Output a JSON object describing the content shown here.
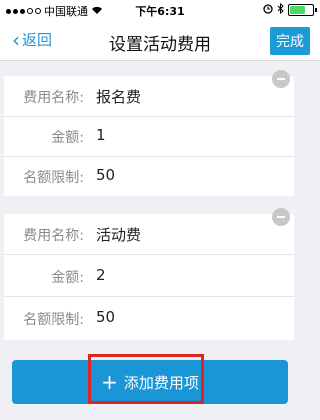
{
  "status": {
    "carrier": "中国联通",
    "time": "下午6:31",
    "battery_level": 0.75
  },
  "nav": {
    "back_label": "返回",
    "title": "设置活动费用",
    "done_label": "完成"
  },
  "fees": [
    {
      "name_label": "费用名称:",
      "name_value": "报名费",
      "amount_label": "金额:",
      "amount_value": "1",
      "limit_label": "名额限制:",
      "limit_value": "50"
    },
    {
      "name_label": "费用名称:",
      "name_value": "活动费",
      "amount_label": "金额:",
      "amount_value": "2",
      "limit_label": "名额限制:",
      "limit_value": "50"
    }
  ],
  "add_button": {
    "label": "添加费用项"
  },
  "colors": {
    "accent": "#1a96d6",
    "highlight": "#e0231f"
  }
}
